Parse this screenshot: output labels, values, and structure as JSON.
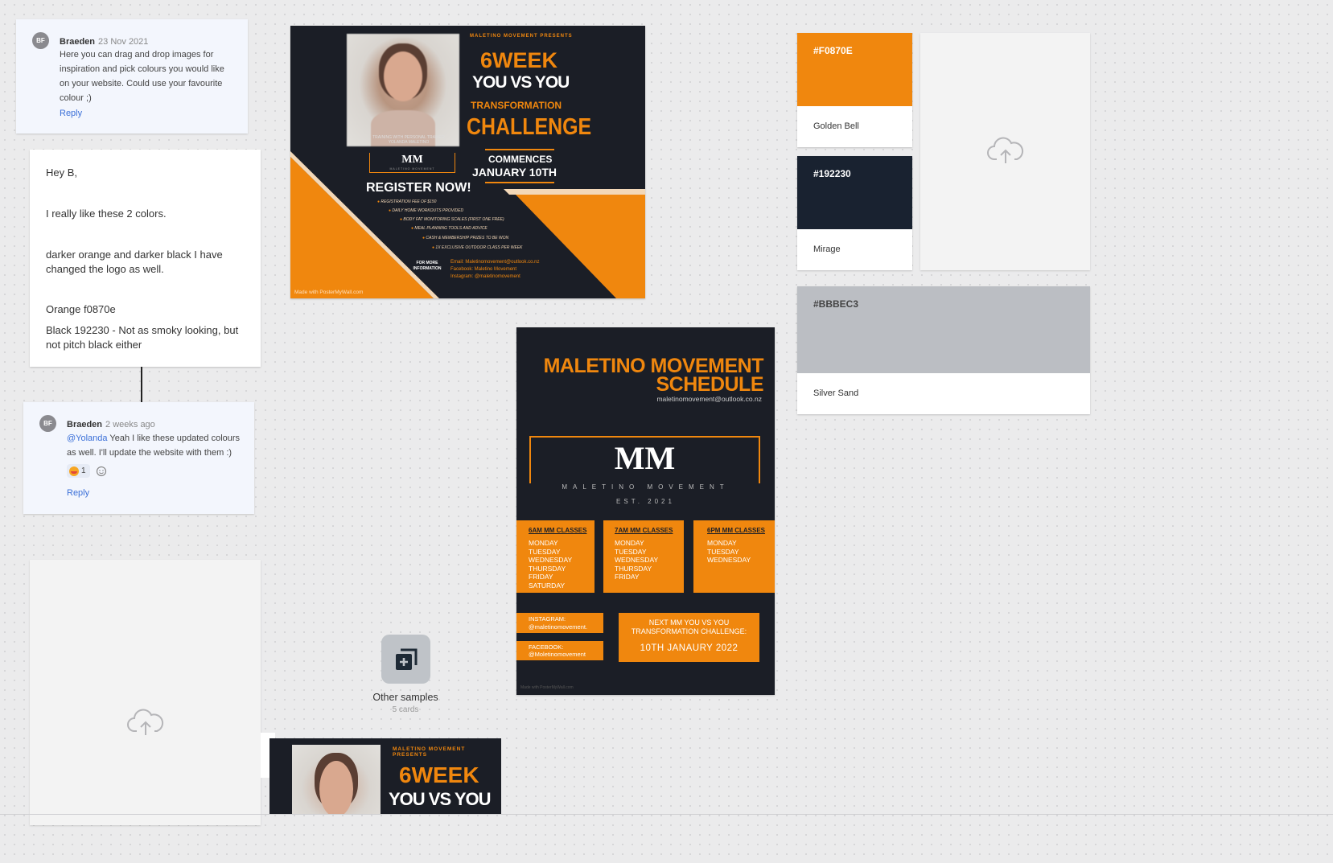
{
  "colors": {
    "orange": "#F0870E",
    "dark": "#192230",
    "grey": "#BBBEC3"
  },
  "comment1": {
    "avatar": "BF",
    "author": "Braeden",
    "time": "23 Nov 2021",
    "body": "Here you can drag and drop images for inspiration and pick colours you would like on your website. Could use your favourite colour ;)",
    "reply": "Reply"
  },
  "note": {
    "lines": [
      "Hey B,",
      "I really like these 2 colors.",
      "darker orange and darker black I have changed the logo as well.",
      "Orange f0870e",
      "Black 192230 - Not as smoky looking, but not pitch black either"
    ]
  },
  "comment2": {
    "avatar": "BF",
    "author": "Braeden",
    "time": "2 weeks ago",
    "mention": "@Yolanda",
    "body": " Yeah I like these updated colours as well. I'll update the website with them :)",
    "reaction_count": "1",
    "reply": "Reply"
  },
  "poster1": {
    "presents": "MALETINO MOVEMENT PRESENTS",
    "line1": "6WEEK",
    "line2": "YOU VS YOU",
    "line3": "TRANSFORMATION",
    "line4": "CHALLENGE",
    "line5": "COMMENCES",
    "line6": "JANUARY 10TH",
    "trainer": "TRAINING WITH PERSONAL TRAINER YOLANDA MALETINO",
    "logo": "MM",
    "logo_sub": "MALETINO MOVEMENT",
    "logo_est": "EST. 2021",
    "register": "REGISTER NOW!",
    "bullets": [
      "REGISTRATION FEE OF $150",
      "DAILY HOME WORKOUTS PROVIDED",
      "BODY FAT MONITORING SCALES (FIRST ONE FREE)",
      "MEAL PLANNING TOOLS AND ADVICE",
      "CASH & MEMBERSHIP PRIZES TO BE WON",
      "1X EXCLUSIVE OUTDOOR CLASS PER WEEK"
    ],
    "more_info": "FOR MORE INFORMATION",
    "email": "Email: Maletinomovement@outlook.co.nz",
    "facebook": "Facebook: Maletino Movement",
    "instagram": "Instagram: @maletinomovement",
    "made_with": "Made with PosterMyWall.com"
  },
  "poster2": {
    "title1": "MALETINO MOVEMENT",
    "title2": "SCHEDULE",
    "email": "maletinomovement@outlook.co.nz",
    "logo": "MM",
    "logo_sub": "MALETINO MOVEMENT",
    "logo_est": "EST. 2021",
    "classes": [
      {
        "title": "6AM MM CLASSES",
        "days": [
          "MONDAY",
          "TUESDAY",
          "WEDNESDAY",
          "THURSDAY",
          "FRIDAY",
          "SATURDAY"
        ]
      },
      {
        "title": "7AM MM CLASSES",
        "days": [
          "MONDAY",
          "TUESDAY",
          "WEDNESDAY",
          "THURSDAY",
          "FRIDAY"
        ]
      },
      {
        "title": "6PM MM CLASSES",
        "days": [
          "MONDAY",
          "TUESDAY",
          "WEDNESDAY"
        ]
      }
    ],
    "instagram_label": "INSTAGRAM:",
    "instagram_value": "@maletinomovement.",
    "facebook_label": "FACEBOOK:",
    "facebook_value": "@Moletinomovement",
    "next_line1": "NEXT MM YOU VS YOU",
    "next_line2": "TRANSFORMATION CHALLENGE:",
    "next_date": "10TH JANAURY 2022",
    "made_with": "Made with PosterMyWall.com"
  },
  "stack": {
    "title": "Other samples",
    "count": "5 cards"
  },
  "poster3": {
    "presents": "MALETINO MOVEMENT PRESENTS",
    "line1": "6WEEK",
    "line2": "YOU VS YOU"
  },
  "swatches": [
    {
      "hex": "#F0870E",
      "name": "Golden Bell"
    },
    {
      "hex": "#192230",
      "name": "Mirage"
    },
    {
      "hex": "#BBBEC3",
      "name": "Silver Sand"
    }
  ],
  "icons": {
    "upload": "cloud-upload-icon",
    "stack": "stack-add-icon",
    "emoji": "smile-emoji-icon",
    "add_reaction": "add-reaction-icon"
  }
}
